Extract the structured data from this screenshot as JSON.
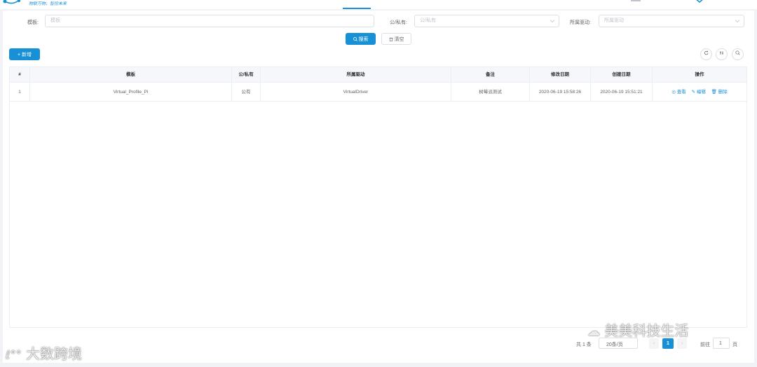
{
  "header": {
    "slogan": "物联万物，智控未来"
  },
  "search": {
    "template_label": "模板:",
    "template_placeholder": "模板",
    "public_private_label": "公/私有:",
    "public_private_placeholder": "公/私有",
    "driver_label": "所属驱动:",
    "driver_placeholder": "所属驱动",
    "search_button": "搜索",
    "clear_button": "清空"
  },
  "toolbar": {
    "add_button": "+ 新增"
  },
  "table": {
    "columns": [
      "#",
      "模板",
      "公/私有",
      "所属驱动",
      "备注",
      "修改日期",
      "创建日期",
      "操作"
    ],
    "rows": [
      {
        "index": "1",
        "template": "Virtual_Profile_Pi",
        "visibility": "公有",
        "driver": "VirtualDriver",
        "remark": "树莓派测试",
        "modified": "2020-06-19 15:58:26",
        "created": "2020-06-19 15:51:21",
        "actions": {
          "view": "查看",
          "edit": "编辑",
          "delete": "删除"
        }
      }
    ]
  },
  "pagination": {
    "total": "共 1 条",
    "page_size": "20条/页",
    "current_page": "1",
    "goto_label": "前往",
    "goto_value": "1",
    "page_suffix": "页"
  },
  "watermarks": {
    "left": "大数跨境",
    "right": "美美科技生活"
  },
  "colors": {
    "primary": "#1890d6",
    "border": "#dcdfe6",
    "header_bg": "#f5f7fa"
  }
}
